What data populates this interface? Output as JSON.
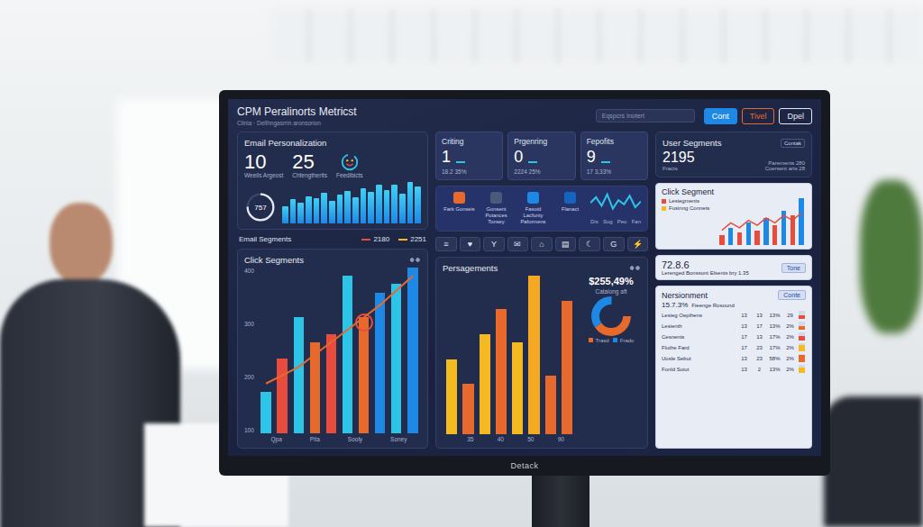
{
  "screen": {
    "title": "CPM Peralinorts Metricst",
    "subtitle": "Clinia · Dellhngasrrin aronsorion",
    "search": {
      "placeholder": "Eqspcrs Inotert"
    },
    "buttons": [
      {
        "label": "Cont",
        "selected": true,
        "color": "#1e88e5"
      },
      {
        "label": "Tivel",
        "selected": false,
        "color": "#e8692c"
      },
      {
        "label": "Dpel",
        "selected": false,
        "color": "#e6e9f0"
      }
    ]
  },
  "email_personalization": {
    "title": "Email Personalization",
    "stats": [
      {
        "value": "10",
        "label": "Weeils Argeost"
      },
      {
        "value": "25",
        "label": "Chfengtherits"
      }
    ],
    "feedback": {
      "label": "Feedlbicts"
    },
    "gauge": {
      "value": "757",
      "level": 0.75
    },
    "bars": [
      40,
      55,
      48,
      62,
      58,
      70,
      52,
      66,
      74,
      60,
      80,
      72,
      88,
      76,
      90,
      68,
      95,
      84
    ]
  },
  "email_segments": {
    "title": "Email Segments",
    "legend": [
      {
        "label": "2180",
        "color": "#e84c3d"
      },
      {
        "label": "2251",
        "color": "#f5b921"
      }
    ]
  },
  "click_segments": {
    "title": "Click Segments",
    "ticks": [
      "400",
      "300",
      "200",
      "100"
    ],
    "x_labels": [
      "Qpa",
      "Pita",
      "Sooly",
      "Soney"
    ],
    "bars": [
      {
        "value": 100,
        "color": "#2ec4e8",
        "highlighted": false
      },
      {
        "value": 180,
        "color": "#e84c3d",
        "highlighted": false
      },
      {
        "value": 280,
        "color": "#2ec4e8",
        "highlighted": false
      },
      {
        "value": 220,
        "color": "#e8692c",
        "highlighted": false
      },
      {
        "value": 240,
        "color": "#e84c3d",
        "highlighted": false
      },
      {
        "value": 380,
        "color": "#2ec4e8",
        "highlighted": false
      },
      {
        "value": 280,
        "color": "#e8692c",
        "highlighted": true
      },
      {
        "value": 340,
        "color": "#1e88e5",
        "highlighted": false
      },
      {
        "value": 360,
        "color": "#2ec4e8",
        "highlighted": false
      },
      {
        "value": 400,
        "color": "#1e88e5",
        "highlighted": false
      }
    ],
    "line": [
      120,
      140,
      160,
      190,
      220,
      250,
      280,
      310,
      345,
      380
    ]
  },
  "kpis": [
    {
      "label": "Criting",
      "value": "1",
      "sub": "18.2 35%"
    },
    {
      "label": "Prgenring",
      "value": "0",
      "sub": "2224 25%"
    },
    {
      "label": "Fepofits",
      "value": "9",
      "sub": "17 3,33%"
    }
  ],
  "features": {
    "items": [
      {
        "label": "Fark Gonseis",
        "color": "#e8692c"
      },
      {
        "label": "Gonsent Potances Tonsey",
        "color": "#4a5a7a"
      },
      {
        "label": "Fasoid Lacfunty Paformens",
        "color": "#1e88e5"
      },
      {
        "label": "Flanact",
        "color": "#1565c0"
      }
    ],
    "wave": [
      50,
      70,
      40,
      80,
      30,
      60,
      45,
      75,
      35,
      55
    ],
    "wave_labels": [
      "Dis",
      "Sug",
      "Peo",
      "Fan"
    ]
  },
  "toolbar": [
    "≡",
    "♥",
    "Y",
    "✉",
    "⌂",
    "▤",
    "☾",
    "G",
    "⚡"
  ],
  "persagements": {
    "title": "Persagements",
    "x_labels": [
      "35",
      "40",
      "50",
      "90"
    ],
    "bars": [
      {
        "value": 45,
        "color": "#f5b921"
      },
      {
        "value": 30,
        "color": "#e8692c"
      },
      {
        "value": 60,
        "color": "#f5b921"
      },
      {
        "value": 75,
        "color": "#e8692c"
      },
      {
        "value": 55,
        "color": "#f5b921"
      },
      {
        "value": 95,
        "color": "#f5a821"
      },
      {
        "value": 35,
        "color": "#e8692c"
      },
      {
        "value": 80,
        "color": "#e8692c"
      }
    ],
    "total": "$255,49%",
    "total_label": "Catalong aft",
    "pie": [
      {
        "label": "Trasd",
        "value": 65,
        "color": "#e8692c"
      },
      {
        "label": "Frado",
        "value": 35,
        "color": "#1e88e5"
      }
    ]
  },
  "user_segments": {
    "title": "User Segments",
    "badge": "Contak",
    "value": "2195",
    "value_label": "Fracts",
    "rows": [
      "Parements 280",
      "Coersent arts 28"
    ]
  },
  "click_segment": {
    "title": "Click Segment",
    "legend": [
      {
        "label": "Lesiegments",
        "color": "#e84c3d"
      },
      {
        "label": "Fusinng Connets",
        "color": "#f5b921"
      }
    ],
    "bars": [
      {
        "value": 20,
        "color": "#e84c3d"
      },
      {
        "value": 35,
        "color": "#1e88e5"
      },
      {
        "value": 25,
        "color": "#e84c3d"
      },
      {
        "value": 45,
        "color": "#1e88e5"
      },
      {
        "value": 30,
        "color": "#e84c3d"
      },
      {
        "value": 55,
        "color": "#1e88e5"
      },
      {
        "value": 40,
        "color": "#e84c3d"
      },
      {
        "value": 70,
        "color": "#1e88e5"
      },
      {
        "value": 60,
        "color": "#e84c3d"
      },
      {
        "value": 95,
        "color": "#1e88e5"
      }
    ],
    "line": [
      30,
      45,
      35,
      50,
      40,
      55,
      45,
      60,
      50,
      65
    ]
  },
  "score": {
    "value": "72.8.6",
    "label": "Lerenged Bonssont Elsents bry 1.35",
    "button": "Tone"
  },
  "retirement": {
    "title": "Nersionment",
    "button": "Conte",
    "value": "15.7.3%",
    "value_label": "Fieenge Rosound",
    "rows": [
      {
        "label": "Lesieg Oepihens",
        "cells": [
          "13",
          "13",
          "13%",
          "29"
        ],
        "color": "#e84c3d",
        "level": 0.4
      },
      {
        "label": "Lesienth",
        "cells": [
          "13",
          "17",
          "13%",
          "2%"
        ],
        "color": "#e8692c",
        "level": 0.5
      },
      {
        "label": "Cesnents",
        "cells": [
          "17",
          "13",
          "17%",
          "2%"
        ],
        "color": "#e84c3d",
        "level": 0.6
      },
      {
        "label": "Fluthe Fard",
        "cells": [
          "17",
          "23",
          "17%",
          "2%"
        ],
        "color": "#f5b921",
        "level": 0.8
      },
      {
        "label": "Uosle Sebut",
        "cells": [
          "13",
          "23",
          "58%",
          "2%"
        ],
        "color": "#e8692c",
        "level": 0.9
      },
      {
        "label": "Fonld Soiut",
        "cells": [
          "13",
          "2",
          "13%",
          "2%"
        ],
        "color": "#f5b921",
        "level": 0.7
      }
    ]
  },
  "monitor": {
    "brand": "Detack"
  }
}
